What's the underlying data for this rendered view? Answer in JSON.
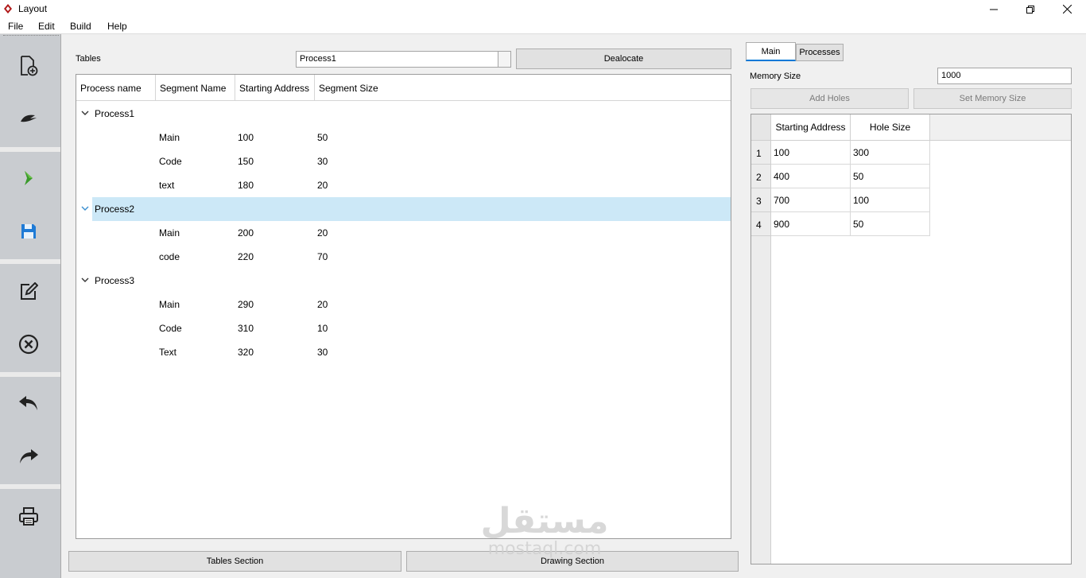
{
  "window": {
    "title": "Layout"
  },
  "menu": [
    "File",
    "Edit",
    "Build",
    "Help"
  ],
  "toolbar": {
    "icons": [
      "new-file-icon",
      "open-icon",
      "run-icon",
      "save-icon",
      "edit-icon",
      "close-circle-icon",
      "undo-icon",
      "redo-icon",
      "print-icon"
    ]
  },
  "tables": {
    "label": "Tables",
    "process_select": "Process1",
    "dealocate_label": "Dealocate",
    "columns": [
      "Process name",
      "Segment Name",
      "Starting Address",
      "Segment Size"
    ],
    "processes": [
      {
        "name": "Process1",
        "segments": [
          {
            "name": "Main",
            "start": "100",
            "size": "50"
          },
          {
            "name": "Code",
            "start": "150",
            "size": "30"
          },
          {
            "name": "text",
            "start": "180",
            "size": "20"
          }
        ]
      },
      {
        "name": "Process2",
        "selected": true,
        "segments": [
          {
            "name": "Main",
            "start": "200",
            "size": "20"
          },
          {
            "name": "code",
            "start": "220",
            "size": "70"
          }
        ]
      },
      {
        "name": "Process3",
        "segments": [
          {
            "name": "Main",
            "start": "290",
            "size": "20"
          },
          {
            "name": "Code",
            "start": "310",
            "size": "10"
          },
          {
            "name": "Text",
            "start": "320",
            "size": "30"
          }
        ]
      }
    ]
  },
  "bottom_buttons": {
    "tables_section": "Tables Section",
    "drawing_section": "Drawing Section"
  },
  "right": {
    "tabs": [
      "Main",
      "Processes"
    ],
    "memory_size_label": "Memory Size",
    "memory_size_value": "1000",
    "add_holes_label": "Add Holes",
    "set_memory_label": "Set Memory Size",
    "holes_columns": [
      "Starting Address",
      "Hole Size"
    ],
    "holes": [
      {
        "num": "1",
        "start": "100",
        "size": "300"
      },
      {
        "num": "2",
        "start": "400",
        "size": "50"
      },
      {
        "num": "3",
        "start": "700",
        "size": "100"
      },
      {
        "num": "4",
        "start": "900",
        "size": "50"
      }
    ]
  },
  "watermark": {
    "arabic": "مستقل",
    "latin": "mostaql.com"
  },
  "colors": {
    "selection": "#cce8f7",
    "toolbar": "#c9ccd0",
    "tab_accent": "#0078d7",
    "run_green": "#3a9a2a",
    "save_blue": "#1f7bd6"
  }
}
